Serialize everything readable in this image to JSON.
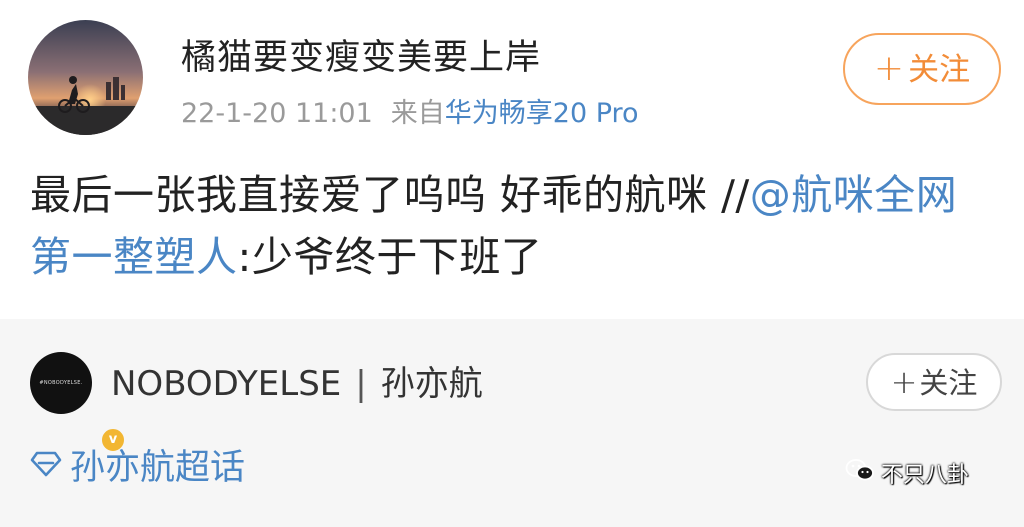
{
  "post": {
    "username": "橘猫要变瘦变美要上岸",
    "timestamp": "22-1-20 11:01",
    "source_prefix": "来自",
    "source_device": "华为畅享20 Pro",
    "follow_plus": "+",
    "follow_label": "关注",
    "text_part1": "最后一张我直接爱了呜呜 好乖的航咪 //",
    "mention": "@航咪全网第一整塑人",
    "text_part2": ":少爷终于下班了"
  },
  "repost": {
    "avatar_text": "#NOBODYELSE.",
    "verified_mark": "v",
    "author_name": "NOBODYELSE",
    "separator": "|",
    "author_alias": "孙亦航",
    "follow_plus": "+",
    "follow_label": "关注",
    "topic_label": "孙亦航超话",
    "topic_icon": "diamond-icon"
  },
  "watermark": {
    "text": "不只八卦",
    "icon": "wechat-icon"
  },
  "colors": {
    "link_blue": "#4a86c5",
    "follow_orange": "#f28c38",
    "repost_bg": "#f6f6f6",
    "verified_gold": "#f2b632"
  }
}
